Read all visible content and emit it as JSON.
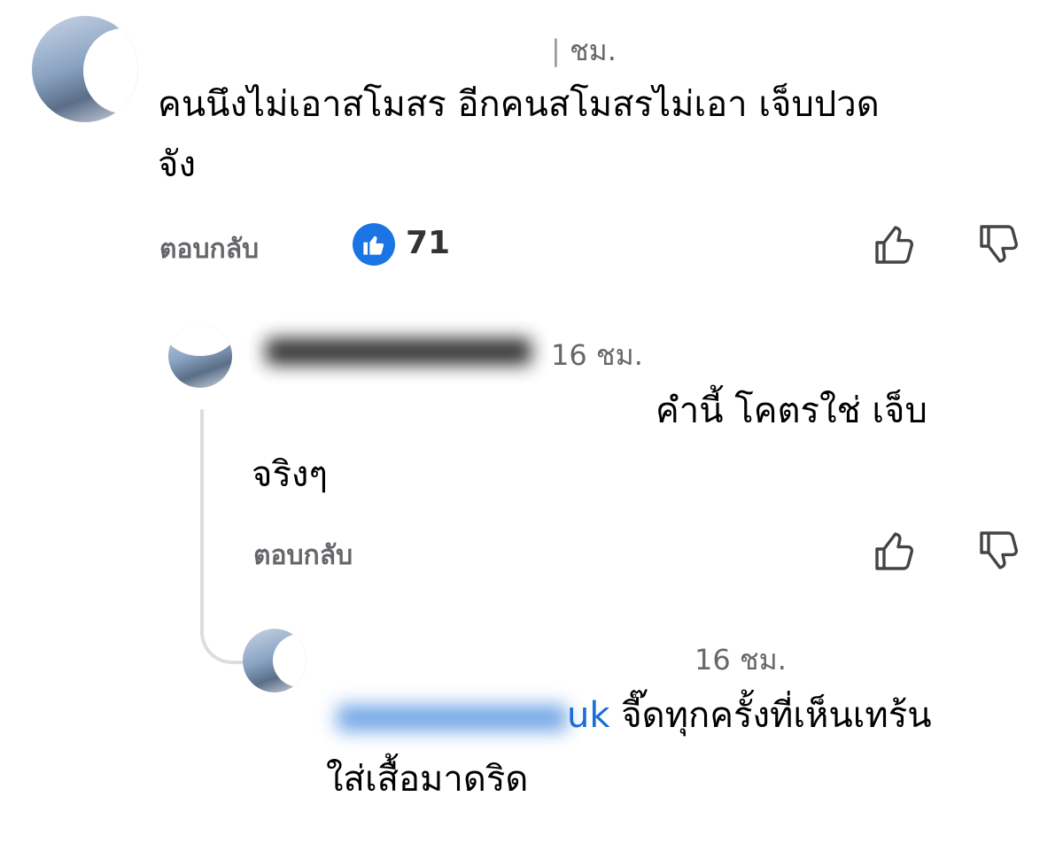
{
  "comments": [
    {
      "time": "ชม.",
      "text_line1": "คนนึงไม่เอาสโมสร อีกคนสโมสรไม่เอา เจ็บปวด",
      "text_line2": "จัง",
      "reply_label": "ตอบกลับ",
      "reaction_count": "71"
    },
    {
      "time": "16 ชม.",
      "text_line1": "คำนี้ โคตรใช่ เจ็บ",
      "text_line2": "จริงๆ",
      "reply_label": "ตอบกลับ"
    },
    {
      "time": "16 ชม.",
      "mention": "uk",
      "text_line1": "จี๊ดทุกครั้งที่เห็นเทร้น",
      "text_line2": "ใส่เสื้อมาดริด"
    }
  ],
  "colors": {
    "like_blue": "#1b74e4",
    "meta_gray": "#65676b",
    "mention_blue": "#1a6fd6",
    "thread_line": "#dadde1"
  },
  "icons": [
    "thumbs-up-icon",
    "thumbs-down-icon",
    "like-reaction-icon"
  ]
}
